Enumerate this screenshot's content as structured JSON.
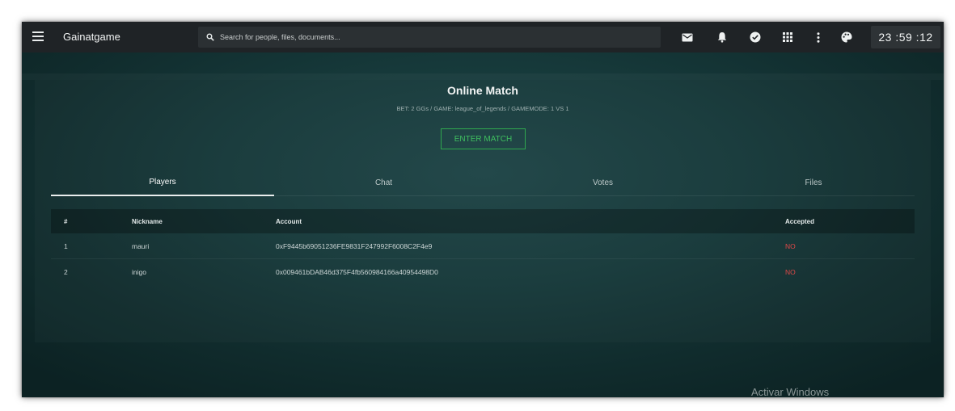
{
  "app": {
    "title": "Gainatgame"
  },
  "search": {
    "placeholder": "Search for people, files, documents..."
  },
  "toolbar_icons": [
    "mail-icon",
    "bell-icon",
    "check-circle-icon",
    "apps-grid-icon",
    "more-vertical-icon",
    "palette-icon"
  ],
  "clock": "23 :59 :12",
  "match": {
    "title": "Online Match",
    "info": "BET: 2 GGs / GAME: league_of_legends / GAMEMODE: 1 VS 1",
    "enter_label": "ENTER MATCH"
  },
  "tabs": [
    {
      "label": "Players",
      "active": true
    },
    {
      "label": "Chat",
      "active": false
    },
    {
      "label": "Votes",
      "active": false
    },
    {
      "label": "Files",
      "active": false
    }
  ],
  "table": {
    "headers": [
      "#",
      "Nickname",
      "Account",
      "Accepted"
    ],
    "rows": [
      {
        "num": "1",
        "nickname": "mauri",
        "account": "0xF9445b69051236FE9831F247992F6008C2F4e9",
        "accepted": "NO"
      },
      {
        "num": "2",
        "nickname": "inigo",
        "account": "0x009461bDAB46d375F4fb560984166a40954498D0",
        "accepted": "NO"
      }
    ]
  },
  "watermark": "Activar Windows",
  "colors": {
    "accent_green": "#3fbf5f",
    "status_no": "#e04848",
    "topbar": "#1f2326"
  }
}
